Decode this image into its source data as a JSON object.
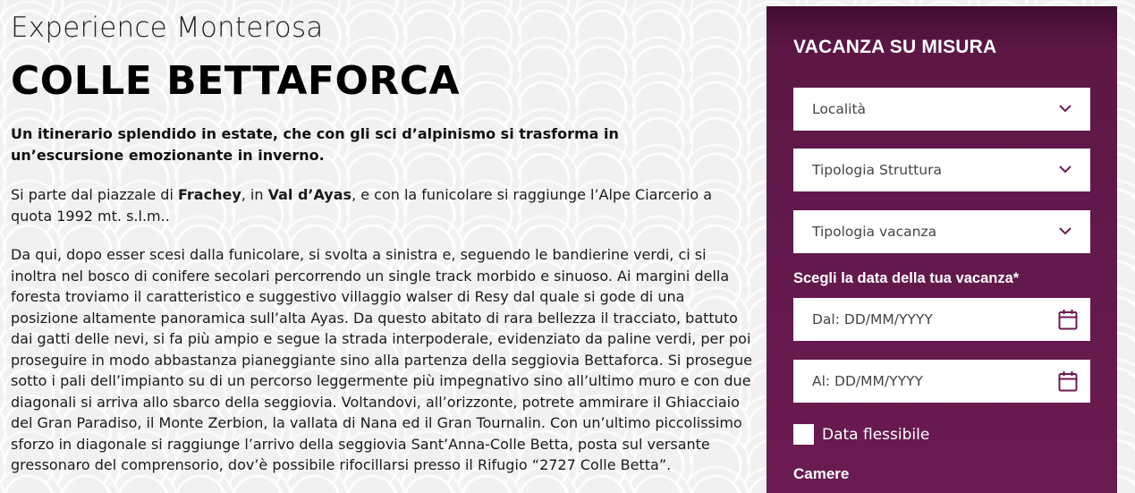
{
  "article": {
    "eyebrow": "Experience Monterosa",
    "title": "COLLE BETTAFORCA",
    "lead": "Un itinerario splendido in estate, che con gli sci d’alpinismo si trasforma in un’escursione emozionante in inverno.",
    "p1": {
      "t1": "Si parte dal piazzale di ",
      "b1": "Frachey",
      "t2": ", in ",
      "b2": "Val d’Ayas",
      "t3": ", e con la funicolare si raggiunge l’Alpe Ciarcerio a quota 1992 mt. s.l.m.."
    },
    "p2": "Da qui, dopo esser scesi dalla funicolare, si svolta a sinistra e, seguendo le bandierine verdi, ci si inoltra nel bosco di conifere secolari percorrendo un single track morbido e sinuoso. Ai margini della foresta troviamo il caratteristico e suggestivo villaggio walser di Resy dal quale si gode di una posizione altamente panoramica sull’alta Ayas. Da questo abitato di rara bellezza il tracciato, battuto dai gatti delle nevi, si fa più ampio e segue la strada interpoderale, evidenziato da paline verdi, per poi proseguire in modo abbastanza pianeggiante sino alla partenza della seggiovia Bettaforca. Si prosegue sotto i pali dell’impianto su di un percorso leggermente più impegnativo sino all’ultimo muro e con due diagonali si arriva allo sbarco della seggiovia. Voltandovi, all’orizzonte, potrete ammirare il Ghiacciaio del Gran Paradiso, il Monte Zerbion, la vallata di Nana ed il Gran Tournalin. Con un’ultimo piccolissimo sforzo in diagonale si raggiunge l’arrivo della seggiovia Sant’Anna-Colle Betta, posta sul versante gressonaro del comprensorio, dov’è possibile rifocillarsi presso il Rifugio “2727 Colle Betta”."
  },
  "panel": {
    "title": "VACANZA SU MISURA",
    "localita": "Località",
    "tipologia_struttura": "Tipologia Struttura",
    "tipologia_vacanza": "Tipologia vacanza",
    "date_label": "Scegli la data della tua vacanza*",
    "date_from": "Dal: DD/MM/YYYY",
    "date_to": "Al: DD/MM/YYYY",
    "flexible_label": "Data flessibile",
    "camere_label": "Camere",
    "chevron_icon": "chevron-down-icon",
    "calendar_icon": "calendar-icon",
    "accent_color": "#6b1b52"
  }
}
